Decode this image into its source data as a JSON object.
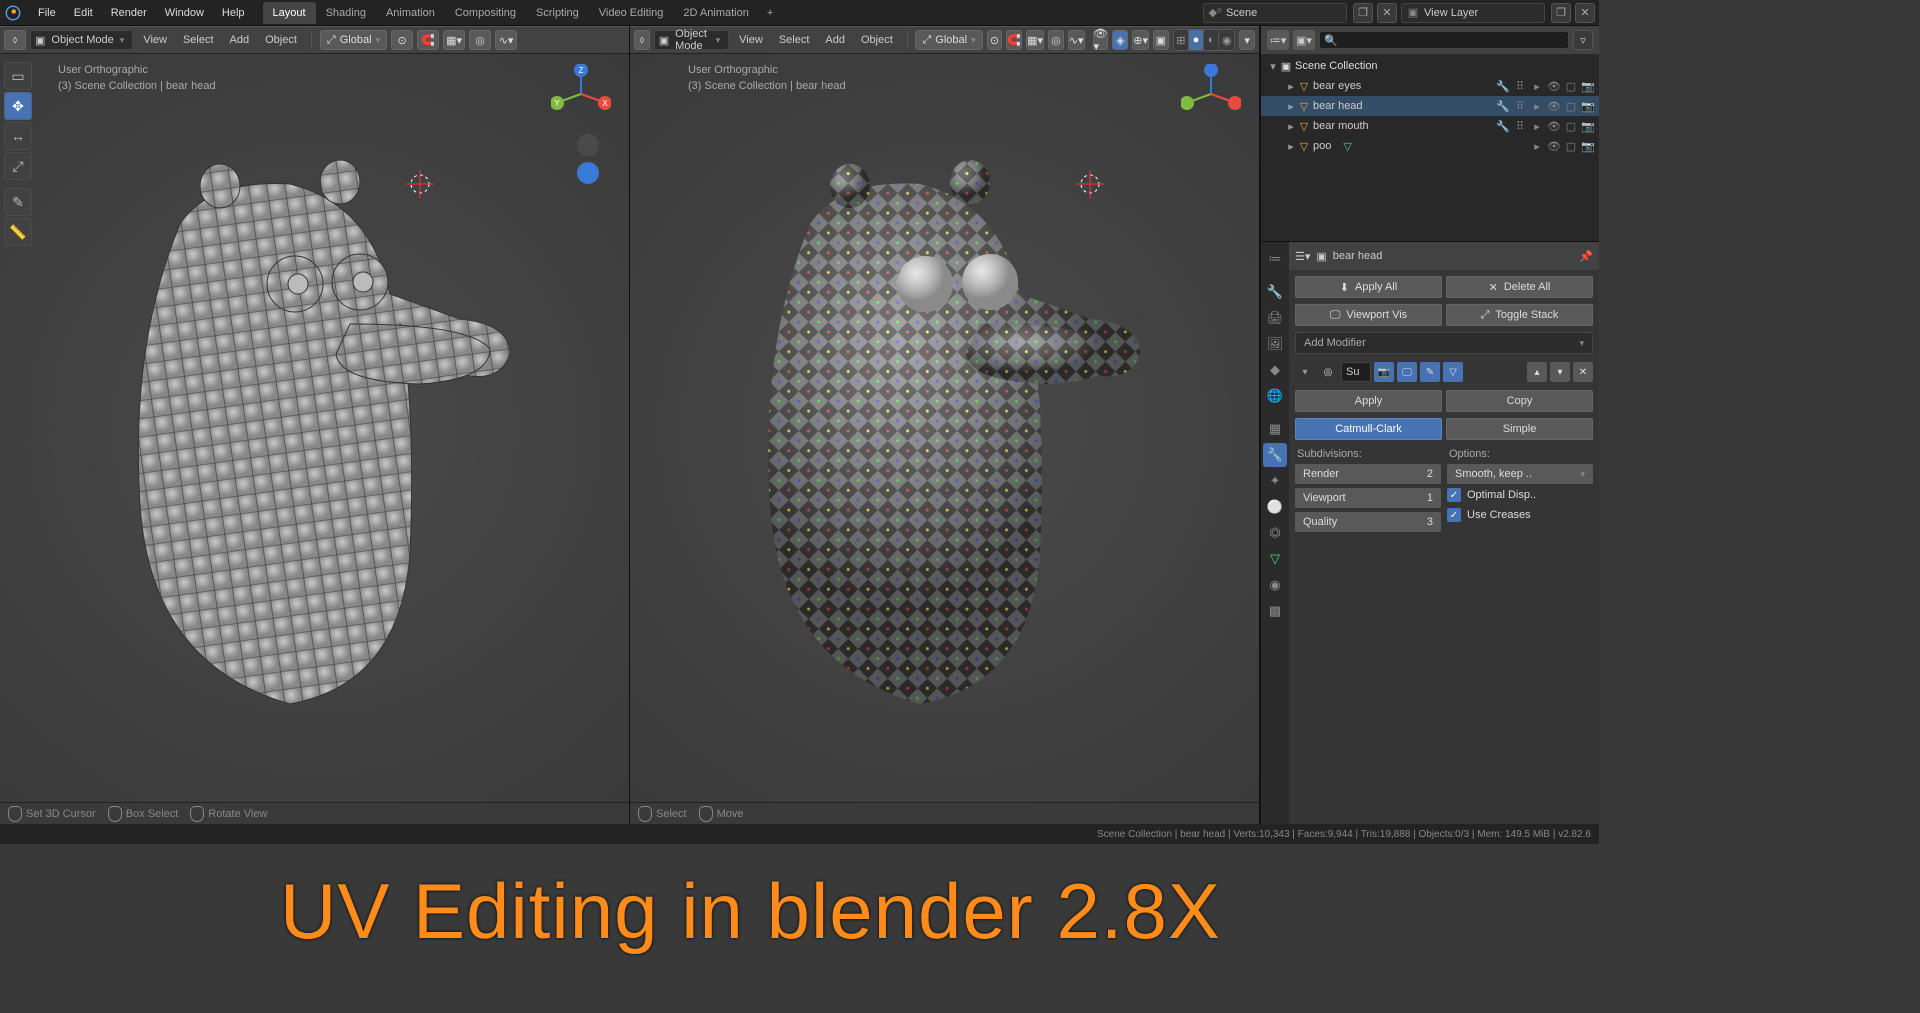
{
  "app": {
    "scene_name": "Scene",
    "view_layer": "View Layer"
  },
  "menu": {
    "file": "File",
    "edit": "Edit",
    "render": "Render",
    "window": "Window",
    "help": "Help"
  },
  "workspaces": [
    "Layout",
    "Shading",
    "Animation",
    "Compositing",
    "Scripting",
    "Video Editing",
    "2D Animation"
  ],
  "viewhdr": {
    "mode": "Object Mode",
    "view": "View",
    "select": "Select",
    "add": "Add",
    "object": "Object",
    "orientation": "Global"
  },
  "viewport": {
    "projection": "User Orthographic",
    "context": "(3) Scene Collection | bear head"
  },
  "toolhints_left": {
    "a": "Set 3D Cursor",
    "b": "Box Select",
    "c": "Rotate View"
  },
  "toolhints_right": {
    "a": "Select",
    "b": "Move"
  },
  "outliner": {
    "collection": "Scene Collection",
    "items": [
      {
        "name": "bear eyes"
      },
      {
        "name": "bear head"
      },
      {
        "name": "bear mouth"
      },
      {
        "name": "poo"
      }
    ]
  },
  "props": {
    "object": "bear head",
    "apply_all": "Apply All",
    "delete_all": "Delete All",
    "viewport_vis": "Viewport Vis",
    "toggle_stack": "Toggle Stack",
    "add_modifier": "Add Modifier",
    "mod_name": "Su",
    "apply": "Apply",
    "copy": "Copy",
    "catmull": "Catmull-Clark",
    "simple": "Simple",
    "subdivisions": "Subdivisions:",
    "options": "Options:",
    "render_lbl": "Render",
    "render_val": "2",
    "viewport_lbl": "Viewport",
    "viewport_val": "1",
    "quality_lbl": "Quality",
    "quality_val": "3",
    "options_sel": "Smooth, keep ..",
    "optimal": "Optimal Disp..",
    "creases": "Use Creases"
  },
  "status": {
    "stats": "Scene Collection | bear head | Verts:10,343 | Faces:9,944 | Tris:19,888 | Objects:0/3 | Mem: 149.5 MiB | v2.82.6"
  },
  "overlay": "UV Editing in blender 2.8X"
}
